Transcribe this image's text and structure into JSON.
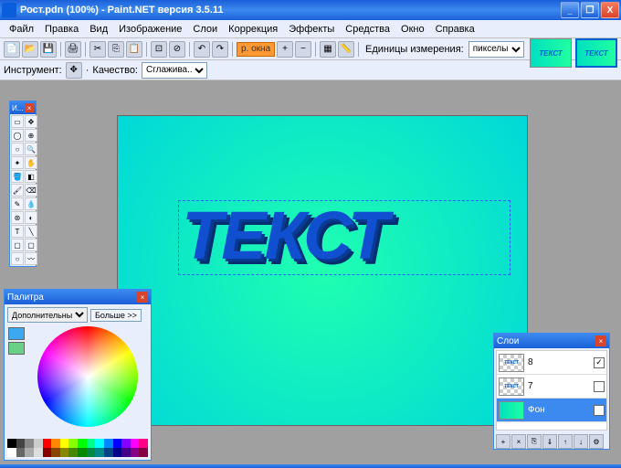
{
  "window": {
    "title": "Рост.pdn (100%) - Paint.NET версия 3.5.11",
    "min": "_",
    "max": "❐",
    "close": "X"
  },
  "menu": [
    "Файл",
    "Правка",
    "Вид",
    "Изображение",
    "Слои",
    "Коррекция",
    "Эффекты",
    "Средства",
    "Окно",
    "Справка"
  ],
  "toolbar": {
    "zoom_value": "р. окна",
    "units_label": "Единицы измерения:",
    "units_value": "пикселы",
    "tool_label": "Инструмент:",
    "quality_label": "Качество:",
    "quality_value": "Сглажива..."
  },
  "thumbs": {
    "label": "ТЕКСТ"
  },
  "canvas": {
    "big_text": "ТЕКСТ"
  },
  "toolbox": {
    "title": "И..."
  },
  "palette": {
    "title": "Палитра",
    "mode": "Дополнительны",
    "more_btn": "Больше >>",
    "primary_color": "#3ca8f0",
    "secondary_color": "#6ad088",
    "strip_top": [
      "#000",
      "#444",
      "#888",
      "#ccc",
      "#f00",
      "#f80",
      "#ff0",
      "#8f0",
      "#0f0",
      "#0f8",
      "#0ff",
      "#08f",
      "#00f",
      "#80f",
      "#f0f",
      "#f08"
    ],
    "strip_bot": [
      "#fff",
      "#666",
      "#aaa",
      "#ddd",
      "#800",
      "#840",
      "#880",
      "#480",
      "#080",
      "#084",
      "#088",
      "#048",
      "#008",
      "#408",
      "#808",
      "#804"
    ]
  },
  "layers": {
    "title": "Слои",
    "items": [
      {
        "name": "8",
        "visible": true,
        "thumb": "text"
      },
      {
        "name": "7",
        "visible": false,
        "thumb": "text"
      },
      {
        "name": "Фон",
        "visible": true,
        "thumb": "bg"
      }
    ]
  }
}
